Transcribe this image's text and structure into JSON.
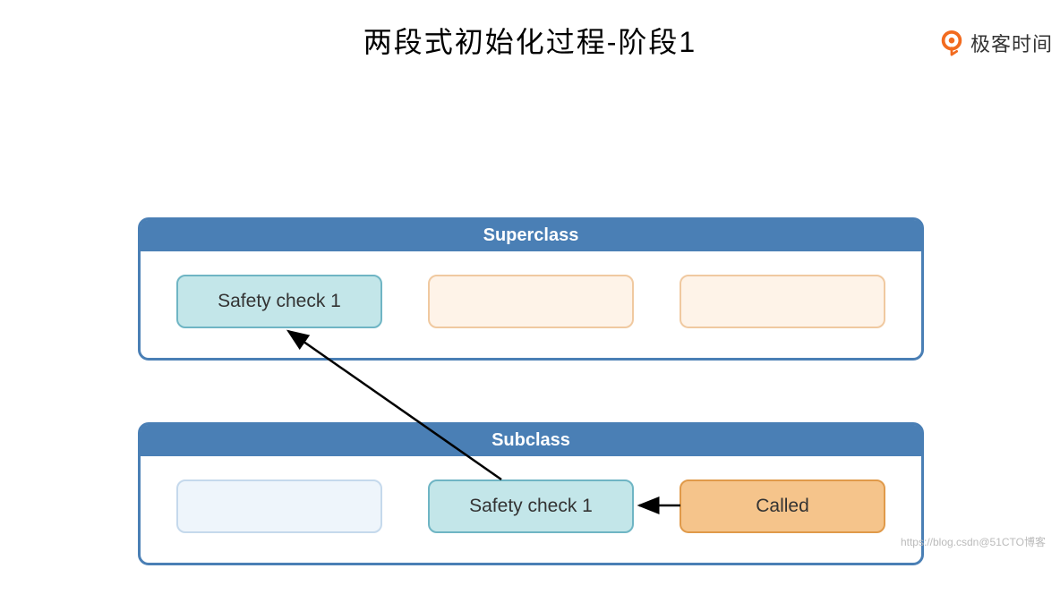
{
  "title": "两段式初始化过程-阶段1",
  "logo": {
    "text": "极客时间",
    "icon_name": "geektime-logo"
  },
  "diagram": {
    "superclass": {
      "header": "Superclass",
      "cells": [
        {
          "label": "Safety check 1",
          "type": "check"
        },
        {
          "label": "",
          "type": "empty-orange"
        },
        {
          "label": "",
          "type": "empty-orange"
        }
      ]
    },
    "subclass": {
      "header": "Subclass",
      "cells": [
        {
          "label": "",
          "type": "empty-blue"
        },
        {
          "label": "Safety check 1",
          "type": "check"
        },
        {
          "label": "Called",
          "type": "called"
        }
      ]
    },
    "arrows": [
      {
        "from": "subclass.called",
        "to": "subclass.safety_check",
        "direction": "left"
      },
      {
        "from": "subclass.safety_check",
        "to": "superclass.safety_check",
        "direction": "up-left"
      }
    ]
  },
  "watermark": "https://blog.csdn@51CTO博客"
}
